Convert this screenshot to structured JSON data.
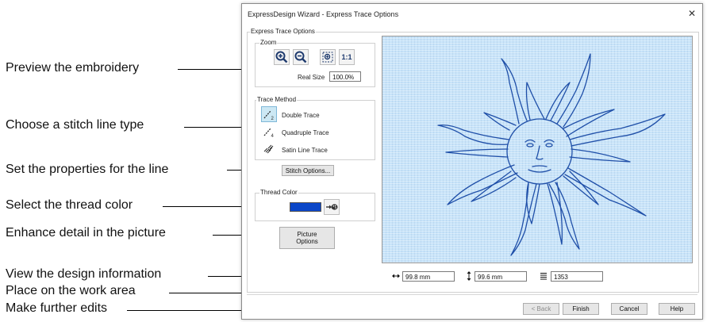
{
  "callouts": [
    "Preview the embroidery",
    "Choose a stitch line type",
    "Set the properties for the line",
    "Select the thread color",
    "Enhance detail in the picture",
    "View the design information",
    "Place on the work area",
    "Make further edits"
  ],
  "dialog": {
    "title": "ExpressDesign Wizard - Express Trace Options",
    "close_glyph": "✕",
    "section_label": "Express Trace Options",
    "zoom": {
      "label": "Zoom",
      "one_to_one": "1:1",
      "real_size_label": "Real Size",
      "real_size_value": "100.0%"
    },
    "trace_method": {
      "label": "Trace Method",
      "options": [
        "Double Trace",
        "Quadruple Trace",
        "Satin Line Trace"
      ],
      "selected_index": 0,
      "stitch_options_label": "Stitch Options..."
    },
    "thread_color": {
      "label": "Thread Color",
      "swatch_color": "#0a46c8"
    },
    "picture_options_label": "Picture\nOptions",
    "info": {
      "width": "99.8 mm",
      "height": "99.6 mm",
      "stitches": "1353"
    },
    "buttons": {
      "back": "< Back",
      "finish": "Finish",
      "cancel": "Cancel",
      "help": "Help"
    },
    "preview": {
      "background": "#c7e3f9",
      "line_color": "#1f4fa8"
    }
  }
}
